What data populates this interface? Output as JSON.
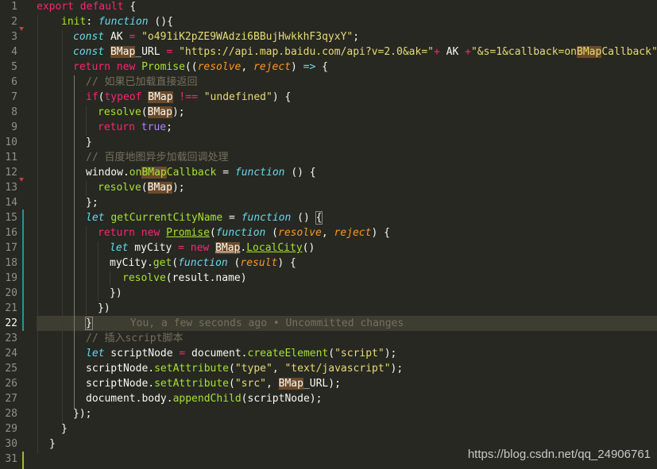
{
  "editor": {
    "line_numbers": [
      "1",
      "2",
      "3",
      "4",
      "5",
      "6",
      "7",
      "8",
      "9",
      "10",
      "11",
      "12",
      "13",
      "14",
      "15",
      "16",
      "17",
      "18",
      "19",
      "20",
      "21",
      "22",
      "23",
      "24",
      "25",
      "26",
      "27",
      "28",
      "29",
      "30",
      "31"
    ],
    "current_line": "22",
    "code": {
      "l1_export": "export",
      "l1_default": "default",
      "l1_brace": " {",
      "l2_init": "init",
      "l2_colon": ": ",
      "l2_function": "function",
      "l2_rest": " (){",
      "l3_const": "const",
      "l3_name": " AK ",
      "l3_eq": "=",
      "l3_sp": " ",
      "l3_str": "\"o491iK2pZE9WAdzi6BBujHwkkhF3qyxY\"",
      "l3_end": ";",
      "l4_const": "const",
      "l4_sp": " ",
      "l4_bmap": "BMap",
      "l4_url": "_URL ",
      "l4_eq": "=",
      "l4_sp2": " ",
      "l4_str": "\"https://api.map.baidu.com/api?v=2.0&ak=\"",
      "l4_plus": "+",
      "l4_ak": " AK ",
      "l4_plus2": "+",
      "l4_str2a": "\"&s=1&callback=on",
      "l4_bmap2": "BMap",
      "l4_str2b": "Callback\"",
      "l4_end": ";",
      "l5_return": "return",
      "l5_new": "new",
      "l5_promise": "Promise",
      "l5_p1": "((",
      "l5_resolve": "resolve",
      "l5_comma": ", ",
      "l5_reject": "reject",
      "l5_p2": ") ",
      "l5_arrow": "=>",
      "l5_brace": " {",
      "l6_comment": "// 如果已加载直接返回",
      "l7_if": "if",
      "l7_p": "(",
      "l7_typeof": "typeof",
      "l7_sp": " ",
      "l7_bmap": "BMap",
      "l7_sp2": " ",
      "l7_neq": "!==",
      "l7_sp3": " ",
      "l7_str": "\"undefined\"",
      "l7_end": ") {",
      "l8_resolve": "resolve",
      "l8_p": "(",
      "l8_bmap": "BMap",
      "l8_end": ");",
      "l9_return": "return",
      "l9_true": "true",
      "l9_end": ";",
      "l10": "}",
      "l11_comment": "// 百度地图异步加载回调处理",
      "l12_window": "window.",
      "l12_on": "on",
      "l12_bmap": "BMap",
      "l12_cb": "Callback",
      "l12_eq": " = ",
      "l12_function": "function",
      "l12_end": " () {",
      "l13_resolve": "resolve",
      "l13_p": "(",
      "l13_bmap": "BMap",
      "l13_end": ");",
      "l14": "};",
      "l15_let": "let",
      "l15_name": "getCurrentCityName",
      "l15_eq": " = ",
      "l15_function": "function",
      "l15_end": " () ",
      "l15_brace": "{",
      "l16_return": "return",
      "l16_new": "new",
      "l16_promise": "Promise",
      "l16_p": "(",
      "l16_function": "function",
      "l16_p2": " (",
      "l16_resolve": "resolve",
      "l16_comma": ", ",
      "l16_reject": "reject",
      "l16_end": ") {",
      "l17_let": "let",
      "l17_name": " myCity ",
      "l17_eq": "=",
      "l17_new": " new ",
      "l17_bmap": "BMap",
      "l17_dot": ".",
      "l17_local": "LocalCity",
      "l17_end": "()",
      "l18_obj": "myCity.",
      "l18_get": "get",
      "l18_p": "(",
      "l18_function": "function",
      "l18_p2": " (",
      "l18_result": "result",
      "l18_end": ") {",
      "l19_resolve": "resolve",
      "l19_rest": "(result.name)",
      "l20": "})",
      "l21": "})",
      "l22_brace": "}",
      "l22_blame": "You, a few seconds ago • Uncommitted changes",
      "l23_comment": "// 插入script脚本",
      "l24_let": "let",
      "l24_name": " scriptNode ",
      "l24_eq": "=",
      "l24_doc": " document.",
      "l24_create": "createElement",
      "l24_p": "(",
      "l24_str": "\"script\"",
      "l24_end": ");",
      "l25_obj": "scriptNode.",
      "l25_set": "setAttribute",
      "l25_p": "(",
      "l25_str1": "\"type\"",
      "l25_comma": ", ",
      "l25_str2": "\"text/javascript\"",
      "l25_end": ");",
      "l26_obj": "scriptNode.",
      "l26_set": "setAttribute",
      "l26_p": "(",
      "l26_str1": "\"src\"",
      "l26_comma": ", ",
      "l26_bmap": "BMap",
      "l26_url": "_URL",
      "l26_end": ");",
      "l27_obj": "document.body.",
      "l27_append": "appendChild",
      "l27_end": "(scriptNode);",
      "l28": "});",
      "l29": "}",
      "l30": "}"
    }
  },
  "watermark": "https://blog.csdn.net/qq_24906761",
  "colors": {
    "background": "#272822",
    "keyword": "#f92672",
    "storage": "#66d9ef",
    "function": "#a6e22e",
    "string": "#e6db74",
    "comment": "#75715e",
    "parameter": "#fd971f",
    "constant": "#ae81ff",
    "git_added": "#2f8d9e",
    "git_modified": "#a0b83b"
  }
}
